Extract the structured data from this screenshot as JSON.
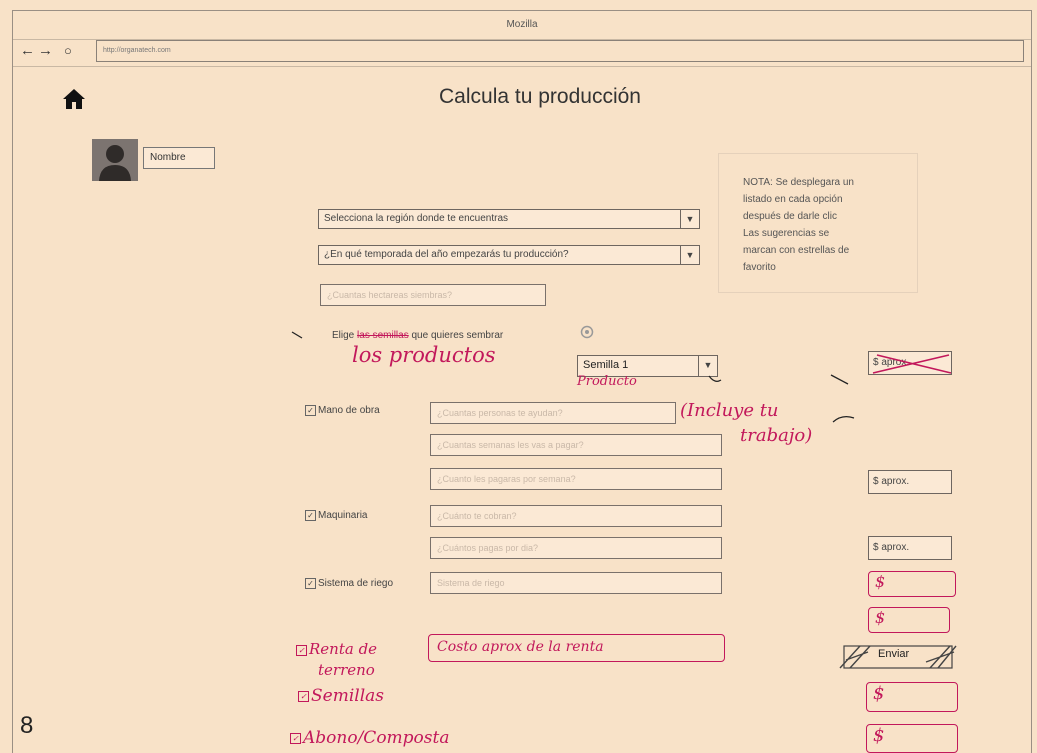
{
  "browser": {
    "title": "Mozilla",
    "url": "http://organatech.com",
    "nav": {
      "back": "←",
      "forward": "→",
      "reload": "○"
    }
  },
  "header": {
    "title": "Calcula tu producción"
  },
  "user": {
    "name_label": "Nombre"
  },
  "note": {
    "lines": [
      "NOTA: Se desplegara un",
      "listado en cada opción",
      "después de darle clic",
      "Las sugerencias se",
      "marcan con estrellas de",
      "favorito"
    ]
  },
  "form": {
    "region_select": "Selecciona la región donde te encuentras",
    "season_select": "¿En qué temporada del año empezarás tu producción?",
    "hectares_placeholder": "¿Cuantas hectareas siembras?",
    "seeds_prefix": "Elige",
    "seeds_struck": "las semillas",
    "seeds_suffix": "que quieres sembrar",
    "seed_select": "Semilla 1",
    "seed_price": "$ aprox.",
    "labor": {
      "label": "Mano de obra",
      "fields": [
        "¿Cuantas personas te ayudan?",
        "¿Cuantas semanas les vas a pagar?",
        "¿Cuanto les pagaras por semana?"
      ],
      "price": "$ aprox."
    },
    "machinery": {
      "label": "Maquinaria",
      "fields": [
        "¿Cuánto te cobran?",
        "¿Cuántos pagas por dia?"
      ],
      "price": "$ aprox."
    },
    "irrigation": {
      "label": "Sistema de riego",
      "field": "Sistema de riego"
    },
    "submit": "Enviar"
  },
  "annotations": {
    "products": "los productos",
    "product": "Producto",
    "include_work_1": "(Incluye tu",
    "include_work_2": "trabajo)",
    "land_rent_1": "Renta de",
    "land_rent_2": "terreno",
    "land_rent_field": "Costo aprox de la renta",
    "seeds": "Semillas",
    "compost": "Abono/Composta",
    "dollar": "$"
  },
  "page_number": "8",
  "colors": {
    "paper": "#f8e2c8",
    "annotation": "#c2185b"
  }
}
